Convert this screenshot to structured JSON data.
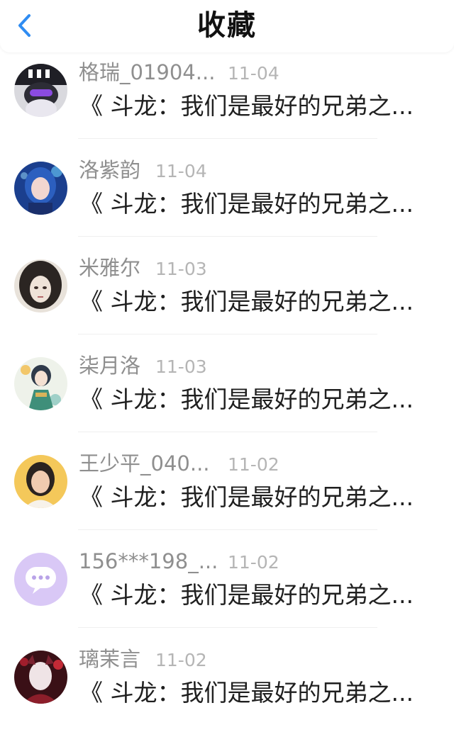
{
  "header": {
    "title": "收藏",
    "back_icon": "chevron-left-icon",
    "accent_color": "#2f8cf2"
  },
  "items": [
    {
      "name": "格瑞_01904...",
      "date": "11-04",
      "content": "《 斗龙：我们是最好的兄弟之...",
      "avatar": "avatar-masked-character"
    },
    {
      "name": "洛紫韵",
      "date": "11-04",
      "content": "《 斗龙：我们是最好的兄弟之...",
      "avatar": "avatar-blue-hair-girl"
    },
    {
      "name": "米雅尔",
      "date": "11-03",
      "content": "《 斗龙：我们是最好的兄弟之...",
      "avatar": "avatar-dark-hair-girl"
    },
    {
      "name": "柒月洛",
      "date": "11-03",
      "content": "《 斗龙：我们是最好的兄弟之...",
      "avatar": "avatar-anime-boy"
    },
    {
      "name": "王少平_040...",
      "date": "11-02",
      "content": "《 斗龙：我们是最好的兄弟之...",
      "avatar": "avatar-person-photo"
    },
    {
      "name": "156***198_...",
      "date": "11-02",
      "content": "《 斗龙：我们是最好的兄弟之...",
      "avatar": "avatar-default-chat-icon"
    },
    {
      "name": "璃茉言",
      "date": "11-02",
      "content": "《 斗龙：我们是最好的兄弟之...",
      "avatar": "avatar-dark-red-character"
    }
  ]
}
